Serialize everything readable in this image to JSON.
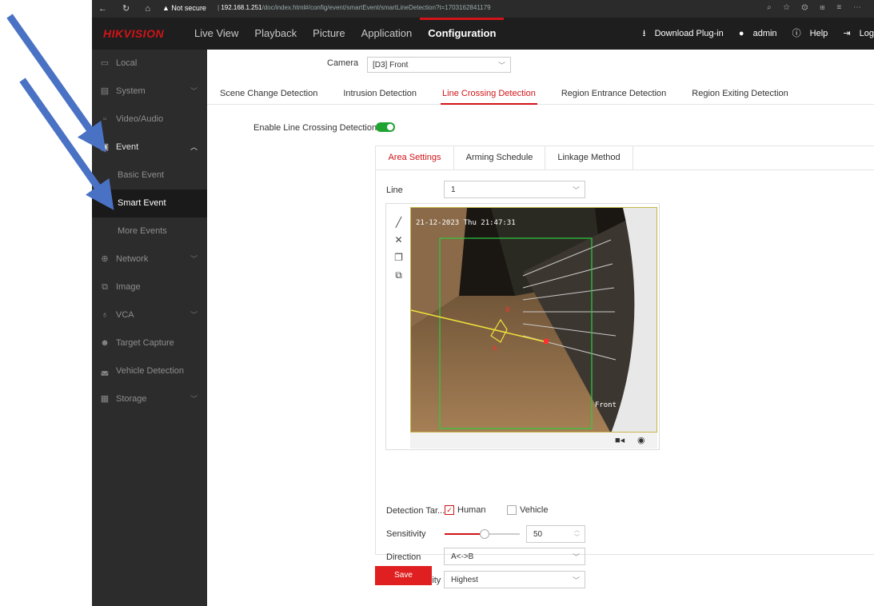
{
  "browser": {
    "security": "Not secure",
    "url_host": "192.168.1.251",
    "url_path": "/doc/index.html#/config/event/smartEvent/smartLineDetection?t=1703162841179"
  },
  "header": {
    "logo": "HIKVISION",
    "nav": [
      "Live View",
      "Playback",
      "Picture",
      "Application",
      "Configuration"
    ],
    "download": "Download Plug-in",
    "user": "admin",
    "help": "Help",
    "logout": "Log"
  },
  "sidebar": {
    "items": [
      {
        "label": "Local",
        "icon": "monitor-icon"
      },
      {
        "label": "System",
        "icon": "system-icon"
      },
      {
        "label": "Video/Audio",
        "icon": "video-icon"
      },
      {
        "label": "Event",
        "icon": "event-icon"
      }
    ],
    "event_sub": [
      "Basic Event",
      "Smart Event",
      "More Events"
    ],
    "items2": [
      {
        "label": "Network",
        "icon": "globe-icon"
      },
      {
        "label": "Image",
        "icon": "image-icon"
      },
      {
        "label": "VCA",
        "icon": "bulb-icon"
      },
      {
        "label": "Target Capture",
        "icon": "person-icon"
      },
      {
        "label": "Vehicle Detection",
        "icon": "car-icon"
      },
      {
        "label": "Storage",
        "icon": "storage-icon"
      }
    ]
  },
  "main": {
    "camera_label": "Camera",
    "camera_value": "[D3] Front",
    "tabs": [
      "Scene Change Detection",
      "Intrusion Detection",
      "Line Crossing Detection",
      "Region Entrance Detection",
      "Region Exiting Detection"
    ],
    "enable_label": "Enable Line Crossing Detection",
    "sub_tabs": [
      "Area Settings",
      "Arming Schedule",
      "Linkage Method"
    ],
    "line_label": "Line",
    "line_value": "1",
    "osd_time": "21-12-2023 Thu 21:47:31",
    "osd_name": "Front",
    "detection_label": "Detection Tar...",
    "human": "Human",
    "vehicle": "Vehicle",
    "sensitivity_label": "Sensitivity",
    "sensitivity_value": "50",
    "direction_label": "Direction",
    "direction_value": "A<->B",
    "validity_label": "Target Validity",
    "validity_value": "Highest",
    "save": "Save"
  },
  "colors": {
    "accent": "#d01418",
    "toggle_on": "#1fa331",
    "arrow": "#4a72c4"
  }
}
